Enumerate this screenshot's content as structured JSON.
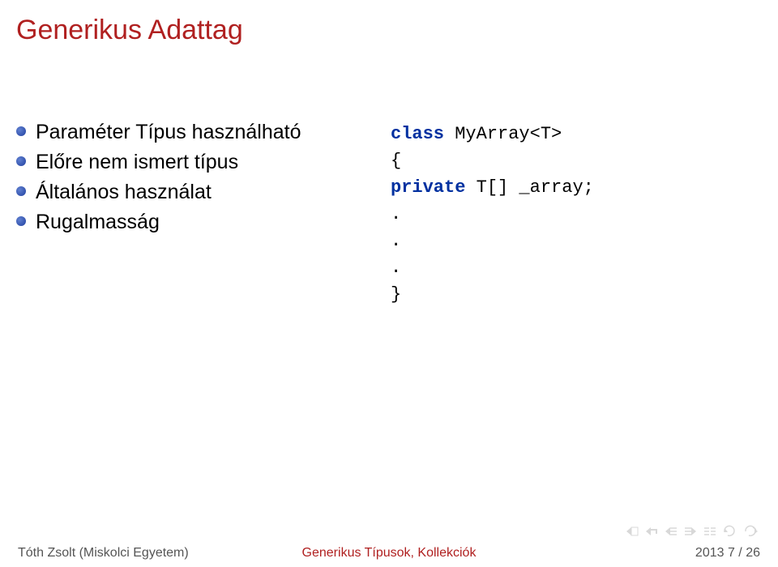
{
  "title": "Generikus Adattag",
  "bullets": [
    "Paraméter Típus használható",
    "Előre nem ismert típus",
    "Általános használat",
    "Rugalmasság"
  ],
  "code": {
    "keyword1": "class",
    "line1_rest": " MyArray<T>",
    "brace_open": "{",
    "keyword2": "private",
    "line2_rest": " T[] _array;",
    "dot1": ".",
    "dot2": ".",
    "dot3": ".",
    "brace_close": "}"
  },
  "footer": {
    "left": "Tóth Zsolt (Miskolci Egyetem)",
    "center": "Generikus Típusok, Kollekciók",
    "right": "2013    7 / 26"
  }
}
